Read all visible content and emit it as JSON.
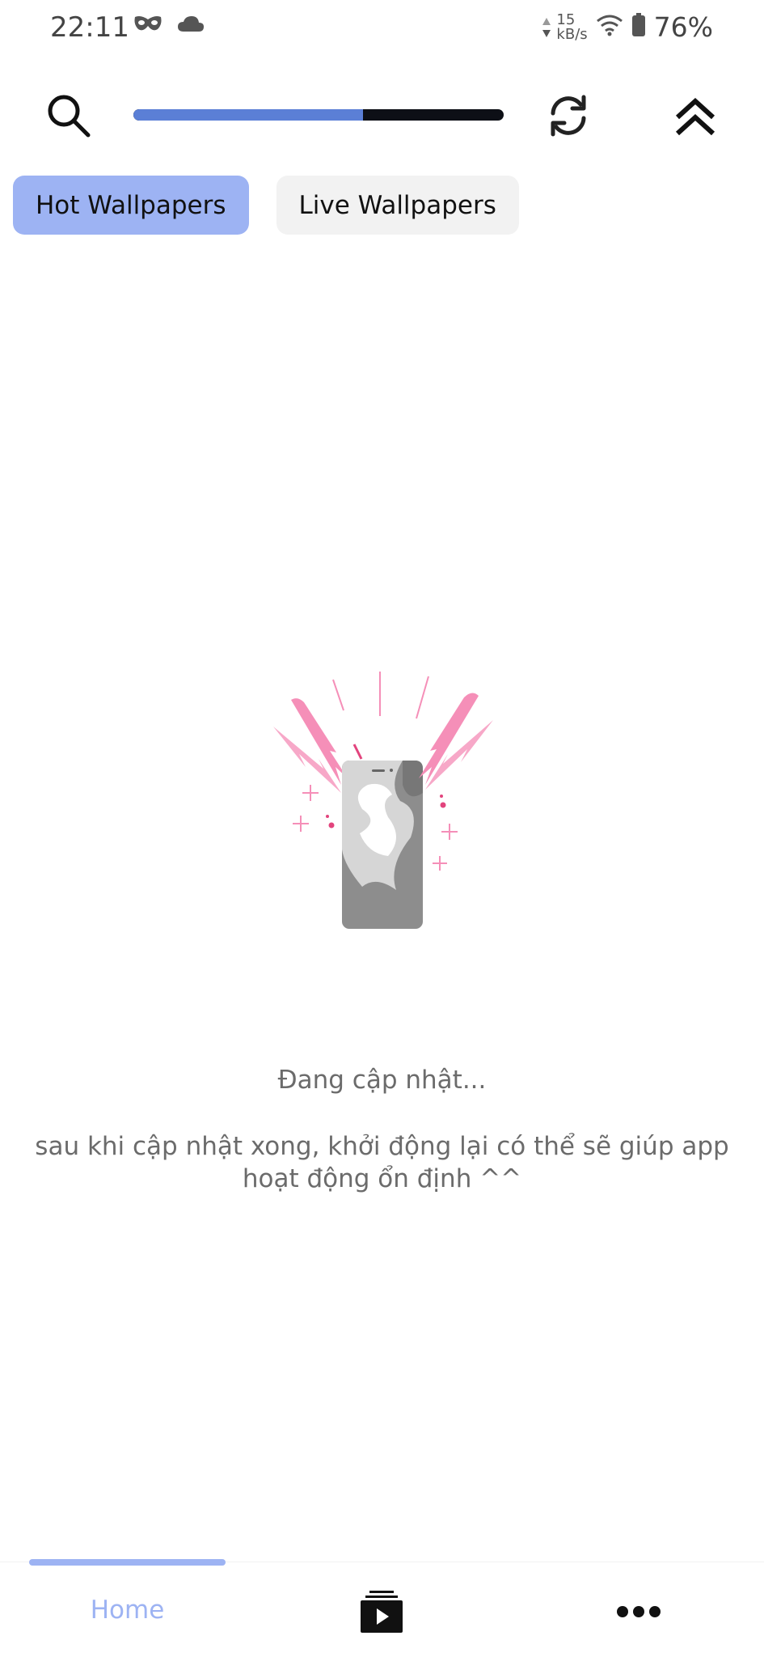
{
  "status_bar": {
    "time": "22:11",
    "icons_left": [
      "mask-icon",
      "cloud-icon"
    ],
    "net_speed_value": "15",
    "net_speed_unit": "kB/s",
    "battery_percent": "76%"
  },
  "toolbar": {
    "progress": 0.62,
    "icons": [
      "search-icon",
      "refresh-icon",
      "double-chevron-up-icon"
    ]
  },
  "tabs": [
    {
      "label": "Hot Wallpapers",
      "active": true
    },
    {
      "label": "Live Wallpapers",
      "active": false
    }
  ],
  "message": {
    "title": "Đang cập nhật...",
    "body": "sau khi cập nhật xong, khởi động lại có thể sẽ giúp app hoạt động ổn định ^^"
  },
  "bottom_nav": {
    "home_label": "Home",
    "icons": [
      "video-play-icon",
      "more-dots-icon"
    ]
  },
  "colors": {
    "accent": "#9db3f3",
    "progress_fill": "#5b7fd6",
    "progress_track": "#0d0f16",
    "illustration_pink": "#f58fb8",
    "text_muted": "#6b6b6b"
  }
}
